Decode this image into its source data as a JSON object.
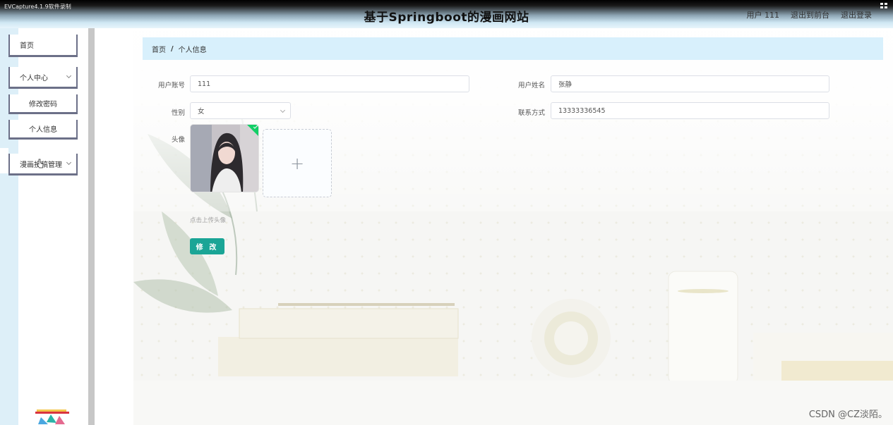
{
  "recorder_label": "EVCapture4.1.9软件录制",
  "header": {
    "title": "基于Springboot的漫画网站",
    "links": [
      "用户 111",
      "退出到前台",
      "退出登录"
    ]
  },
  "sidebar": {
    "items": [
      {
        "label": "首页"
      },
      {
        "label": "个人中心"
      },
      {
        "label": "修改密码"
      },
      {
        "label": "个人信息"
      },
      {
        "label": "漫画投稿管理"
      }
    ]
  },
  "breadcrumb": {
    "home": "首页",
    "separator": "/",
    "current": "个人信息"
  },
  "form": {
    "account_label": "用户账号",
    "account_value": "111",
    "name_label": "用户姓名",
    "name_value": "张静",
    "gender_label": "性别",
    "gender_value": "女",
    "phone_label": "联系方式",
    "phone_value": "13333336545",
    "avatar_label": "头像",
    "upload_plus": "+",
    "upload_hint": "点击上传头像",
    "submit_label": "修 改"
  },
  "colors": {
    "breadcrumb_bg": "#d8f0fc",
    "submit_bg": "#1aa596",
    "menu_border": "#6c7088"
  },
  "watermark": "CSDN @CZ淡陌。"
}
